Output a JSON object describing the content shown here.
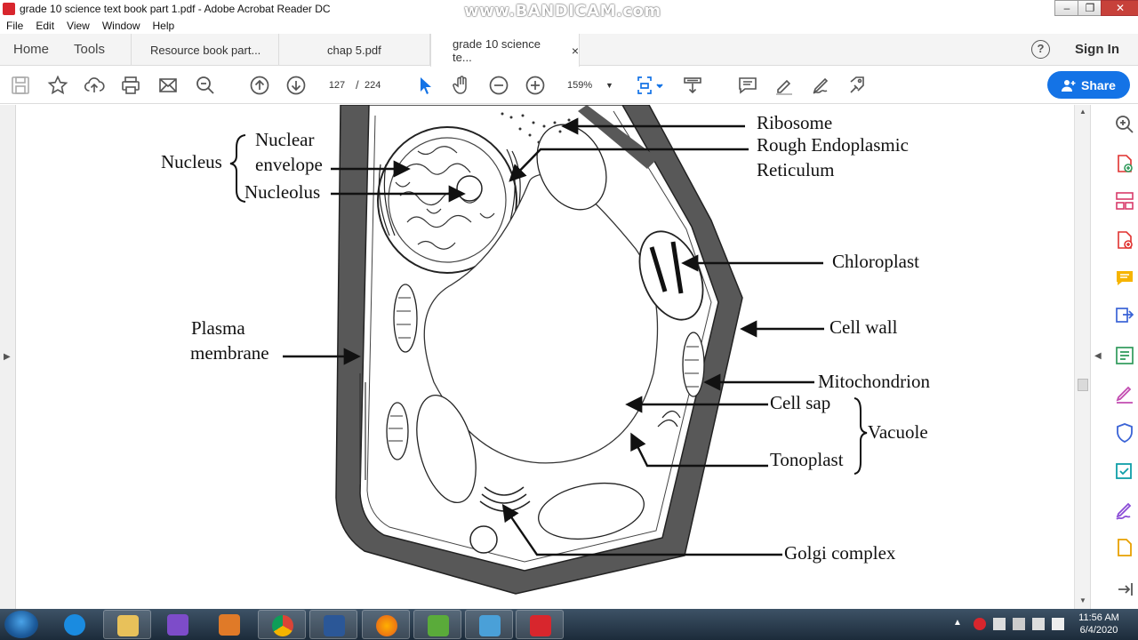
{
  "window": {
    "title": "grade 10 science text book part 1.pdf - Adobe Acrobat Reader DC",
    "watermark": "www.BANDICAM.com",
    "minimize": "–",
    "restore": "❐",
    "close": "✕"
  },
  "menu": [
    "File",
    "Edit",
    "View",
    "Window",
    "Help"
  ],
  "nav": {
    "home": "Home",
    "tools": "Tools",
    "signin": "Sign In",
    "help": "?"
  },
  "tabs": [
    {
      "label": "Resource book part..."
    },
    {
      "label": "chap 5.pdf"
    },
    {
      "label": "grade 10 science te...",
      "close": "×"
    }
  ],
  "toolbar": {
    "page_current": "127",
    "page_separator": "/",
    "page_total": "224",
    "zoom": "159%",
    "share": "Share"
  },
  "diagram": {
    "labels": {
      "nucleus": "Nucleus",
      "nuclear": "Nuclear",
      "envelope": "envelope",
      "nucleolus": "Nucleolus",
      "plasma": "Plasma",
      "membrane": "membrane",
      "ribosome": "Ribosome",
      "rough_er_1": "Rough Endoplasmic",
      "rough_er_2": "Reticulum",
      "chloroplast": "Chloroplast",
      "cell_wall": "Cell wall",
      "mitochondrion": "Mitochondrion",
      "cell_sap": "Cell sap",
      "vacuole": "Vacuole",
      "tonoplast": "Tonoplast",
      "golgi": "Golgi complex"
    }
  },
  "taskbar": {
    "clock_time": "11:56 AM",
    "clock_date": "6/4/2020"
  }
}
